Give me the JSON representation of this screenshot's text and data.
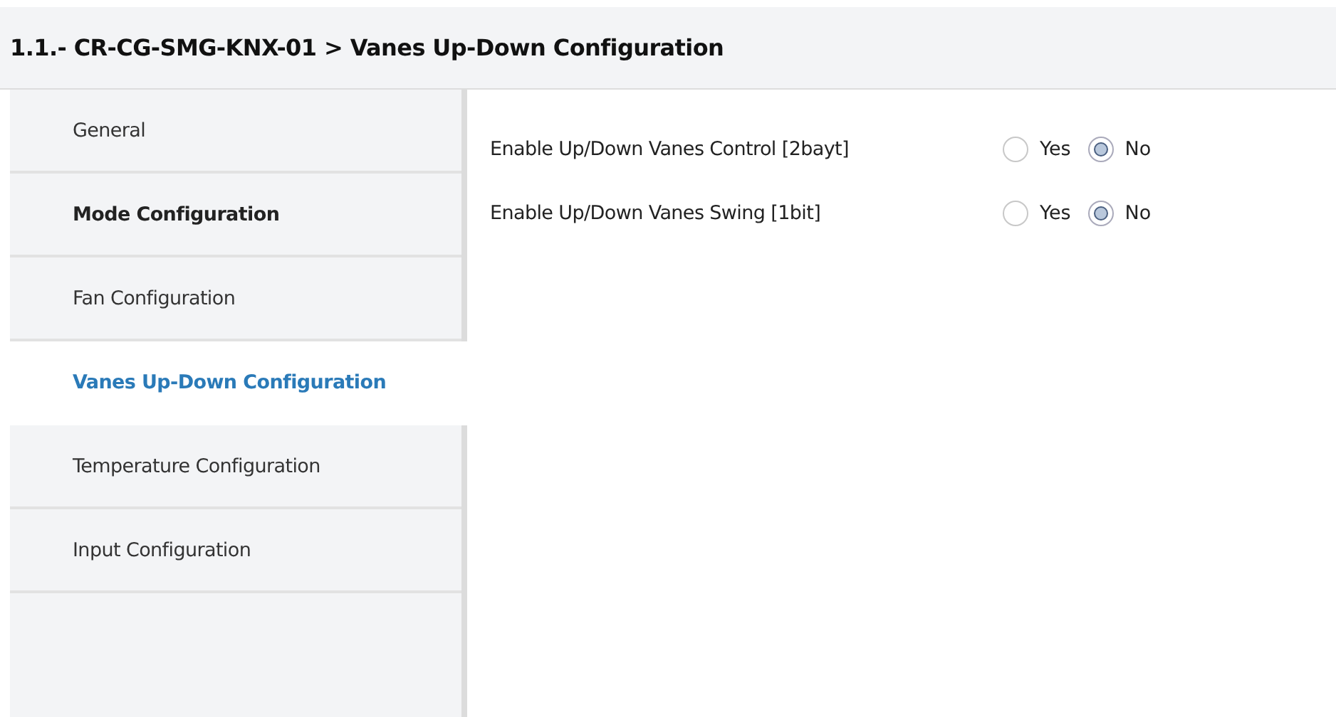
{
  "header": {
    "title": "1.1.- CR-CG-SMG-KNX-01 > Vanes Up-Down Configuration"
  },
  "sidebar": {
    "items": [
      {
        "label": "General",
        "selected": false,
        "bold": false
      },
      {
        "label": "Mode Configuration",
        "selected": false,
        "bold": true
      },
      {
        "label": "Fan Configuration",
        "selected": false,
        "bold": false
      },
      {
        "label": "Vanes Up-Down Configuration",
        "selected": true,
        "bold": false
      },
      {
        "label": "Temperature Configuration",
        "selected": false,
        "bold": false
      },
      {
        "label": "Input Configuration",
        "selected": false,
        "bold": false
      }
    ]
  },
  "parameters": [
    {
      "label": "Enable Up/Down Vanes Control [2bayt]",
      "options": [
        {
          "label": "Yes",
          "selected": false
        },
        {
          "label": "No",
          "selected": true
        }
      ]
    },
    {
      "label": "Enable Up/Down Vanes Swing [1bit]",
      "options": [
        {
          "label": "Yes",
          "selected": false
        },
        {
          "label": "No",
          "selected": true
        }
      ]
    }
  ]
}
